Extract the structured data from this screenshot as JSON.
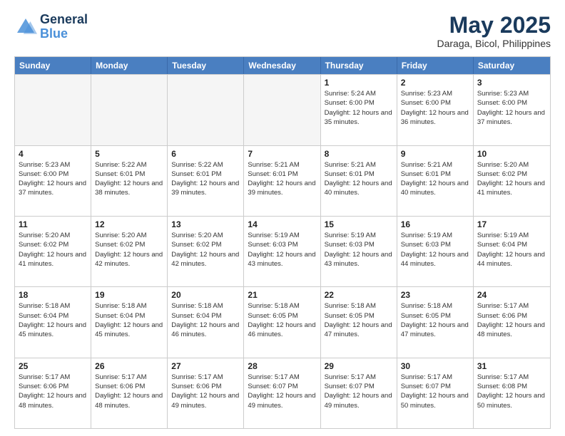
{
  "header": {
    "logo_line1": "General",
    "logo_line2": "Blue",
    "title": "May 2025",
    "subtitle": "Daraga, Bicol, Philippines"
  },
  "weekdays": [
    "Sunday",
    "Monday",
    "Tuesday",
    "Wednesday",
    "Thursday",
    "Friday",
    "Saturday"
  ],
  "rows": [
    [
      {
        "day": "",
        "empty": true
      },
      {
        "day": "",
        "empty": true
      },
      {
        "day": "",
        "empty": true
      },
      {
        "day": "",
        "empty": true
      },
      {
        "day": "1",
        "sunrise": "5:24 AM",
        "sunset": "6:00 PM",
        "daylight": "12 hours and 35 minutes."
      },
      {
        "day": "2",
        "sunrise": "5:23 AM",
        "sunset": "6:00 PM",
        "daylight": "12 hours and 36 minutes."
      },
      {
        "day": "3",
        "sunrise": "5:23 AM",
        "sunset": "6:00 PM",
        "daylight": "12 hours and 37 minutes."
      }
    ],
    [
      {
        "day": "4",
        "sunrise": "5:23 AM",
        "sunset": "6:00 PM",
        "daylight": "12 hours and 37 minutes."
      },
      {
        "day": "5",
        "sunrise": "5:22 AM",
        "sunset": "6:01 PM",
        "daylight": "12 hours and 38 minutes."
      },
      {
        "day": "6",
        "sunrise": "5:22 AM",
        "sunset": "6:01 PM",
        "daylight": "12 hours and 39 minutes."
      },
      {
        "day": "7",
        "sunrise": "5:21 AM",
        "sunset": "6:01 PM",
        "daylight": "12 hours and 39 minutes."
      },
      {
        "day": "8",
        "sunrise": "5:21 AM",
        "sunset": "6:01 PM",
        "daylight": "12 hours and 40 minutes."
      },
      {
        "day": "9",
        "sunrise": "5:21 AM",
        "sunset": "6:01 PM",
        "daylight": "12 hours and 40 minutes."
      },
      {
        "day": "10",
        "sunrise": "5:20 AM",
        "sunset": "6:02 PM",
        "daylight": "12 hours and 41 minutes."
      }
    ],
    [
      {
        "day": "11",
        "sunrise": "5:20 AM",
        "sunset": "6:02 PM",
        "daylight": "12 hours and 41 minutes."
      },
      {
        "day": "12",
        "sunrise": "5:20 AM",
        "sunset": "6:02 PM",
        "daylight": "12 hours and 42 minutes."
      },
      {
        "day": "13",
        "sunrise": "5:20 AM",
        "sunset": "6:02 PM",
        "daylight": "12 hours and 42 minutes."
      },
      {
        "day": "14",
        "sunrise": "5:19 AM",
        "sunset": "6:03 PM",
        "daylight": "12 hours and 43 minutes."
      },
      {
        "day": "15",
        "sunrise": "5:19 AM",
        "sunset": "6:03 PM",
        "daylight": "12 hours and 43 minutes."
      },
      {
        "day": "16",
        "sunrise": "5:19 AM",
        "sunset": "6:03 PM",
        "daylight": "12 hours and 44 minutes."
      },
      {
        "day": "17",
        "sunrise": "5:19 AM",
        "sunset": "6:04 PM",
        "daylight": "12 hours and 44 minutes."
      }
    ],
    [
      {
        "day": "18",
        "sunrise": "5:18 AM",
        "sunset": "6:04 PM",
        "daylight": "12 hours and 45 minutes."
      },
      {
        "day": "19",
        "sunrise": "5:18 AM",
        "sunset": "6:04 PM",
        "daylight": "12 hours and 45 minutes."
      },
      {
        "day": "20",
        "sunrise": "5:18 AM",
        "sunset": "6:04 PM",
        "daylight": "12 hours and 46 minutes."
      },
      {
        "day": "21",
        "sunrise": "5:18 AM",
        "sunset": "6:05 PM",
        "daylight": "12 hours and 46 minutes."
      },
      {
        "day": "22",
        "sunrise": "5:18 AM",
        "sunset": "6:05 PM",
        "daylight": "12 hours and 47 minutes."
      },
      {
        "day": "23",
        "sunrise": "5:18 AM",
        "sunset": "6:05 PM",
        "daylight": "12 hours and 47 minutes."
      },
      {
        "day": "24",
        "sunrise": "5:17 AM",
        "sunset": "6:06 PM",
        "daylight": "12 hours and 48 minutes."
      }
    ],
    [
      {
        "day": "25",
        "sunrise": "5:17 AM",
        "sunset": "6:06 PM",
        "daylight": "12 hours and 48 minutes."
      },
      {
        "day": "26",
        "sunrise": "5:17 AM",
        "sunset": "6:06 PM",
        "daylight": "12 hours and 48 minutes."
      },
      {
        "day": "27",
        "sunrise": "5:17 AM",
        "sunset": "6:06 PM",
        "daylight": "12 hours and 49 minutes."
      },
      {
        "day": "28",
        "sunrise": "5:17 AM",
        "sunset": "6:07 PM",
        "daylight": "12 hours and 49 minutes."
      },
      {
        "day": "29",
        "sunrise": "5:17 AM",
        "sunset": "6:07 PM",
        "daylight": "12 hours and 49 minutes."
      },
      {
        "day": "30",
        "sunrise": "5:17 AM",
        "sunset": "6:07 PM",
        "daylight": "12 hours and 50 minutes."
      },
      {
        "day": "31",
        "sunrise": "5:17 AM",
        "sunset": "6:08 PM",
        "daylight": "12 hours and 50 minutes."
      }
    ]
  ]
}
